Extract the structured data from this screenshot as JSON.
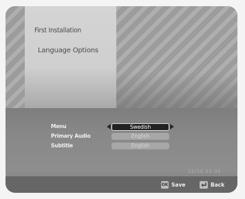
{
  "header": {
    "title": "First Installation",
    "subtitle": "Language Options"
  },
  "settings": [
    {
      "label": "Menu",
      "value": "Swedish",
      "active": true
    },
    {
      "label": "Primary Audio",
      "value": "English",
      "active": false
    },
    {
      "label": "Subtitle",
      "value": "English",
      "active": false
    }
  ],
  "status": {
    "timestamp": "12/10 21:31"
  },
  "footer": {
    "save_key": "OK",
    "save_label": "Save",
    "back_label": "Back"
  },
  "colors": {
    "active_box": "#222222",
    "inactive_box": "#a7a7a7",
    "footer": "#666666"
  }
}
